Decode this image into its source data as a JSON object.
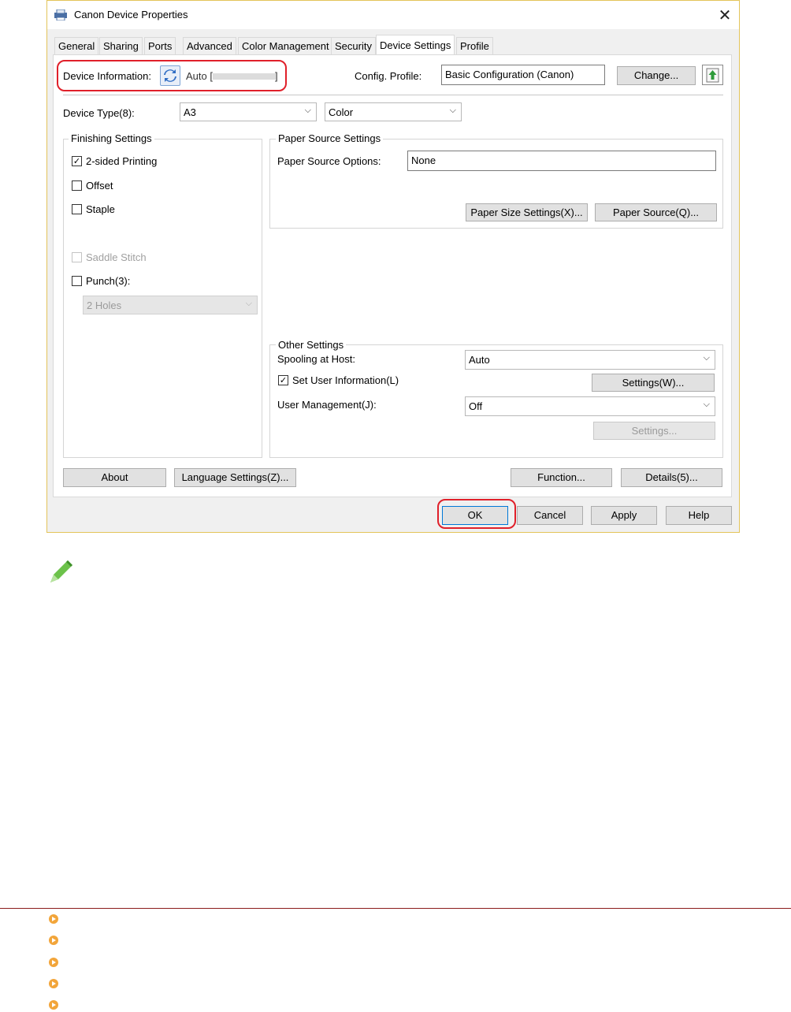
{
  "window": {
    "title": "Canon Device Properties",
    "close_glyph": "✕",
    "tabs": [
      {
        "label": "General"
      },
      {
        "label": "Sharing"
      },
      {
        "label": "Ports"
      },
      {
        "label": "Advanced"
      },
      {
        "label": "Color Management"
      },
      {
        "label": "Security"
      },
      {
        "label": "Device Settings",
        "active": true
      },
      {
        "label": "Profile"
      }
    ]
  },
  "device_info": {
    "label": "Device Information:",
    "mode": "Auto [",
    "mode_end": "]",
    "config_label": "Config. Profile:",
    "config_value": "Basic Configuration (Canon)",
    "change_button": "Change...",
    "device_type_label": "Device Type(8):",
    "device_type_value": "A3",
    "color_value": "Color"
  },
  "finishing": {
    "title": "Finishing Settings",
    "two_sided": {
      "label": "2-sided Printing",
      "checked": true
    },
    "offset": {
      "label": "Offset",
      "checked": false
    },
    "staple": {
      "label": "Staple",
      "checked": false
    },
    "saddle": {
      "label": "Saddle Stitch",
      "checked": false,
      "disabled": true
    },
    "punch": {
      "label": "Punch(3):",
      "checked": false
    },
    "punch_value": "2 Holes"
  },
  "paper_source": {
    "title": "Paper Source Settings",
    "options_label": "Paper Source Options:",
    "options_value": "None",
    "size_button": "Paper Size Settings(X)...",
    "source_button": "Paper Source(Q)..."
  },
  "other": {
    "title": "Other Settings",
    "spooling_label": "Spooling at Host:",
    "spooling_value": "Auto",
    "set_user_label": "Set User Information(L)",
    "set_user_checked": true,
    "settings_w_button": "Settings(W)...",
    "user_mgmt_label": "User Management(J):",
    "user_mgmt_value": "Off",
    "settings_button": "Settings..."
  },
  "bottom": {
    "about": "About",
    "language": "Language Settings(Z)...",
    "function": "Function...",
    "details": "Details(5)..."
  },
  "dialog_buttons": {
    "ok": "OK",
    "cancel": "Cancel",
    "apply": "Apply",
    "help": "Help"
  },
  "colors": {
    "highlight": "#e0202a",
    "window_border": "#e3c45a",
    "link_icon": "#f2a53a",
    "rule": "#8b1c1c"
  },
  "icons": [
    "printer-icon",
    "refresh-icon",
    "upload-icon",
    "pencil-icon",
    "circle-arrow-icon"
  ]
}
